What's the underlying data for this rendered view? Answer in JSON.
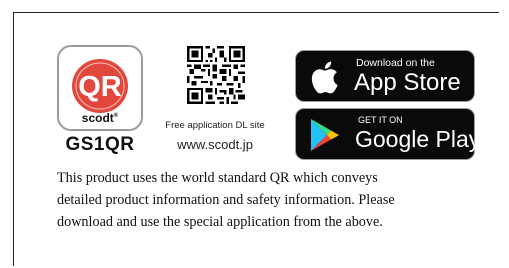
{
  "app_icon": {
    "brand": "scodt",
    "registered_mark": "®",
    "logo_text": "QR",
    "logo_color": "#e2473d",
    "name": "GS1QR"
  },
  "download_info": {
    "free_app_text": "Free application DL site",
    "site_url": "www.scodt.jp"
  },
  "store_buttons": {
    "app_store": {
      "small": "Download on the",
      "big": "App Store",
      "icon": "apple-icon"
    },
    "google_play": {
      "small": "GET IT ON",
      "big": "Google Play",
      "icon": "google-play-icon"
    }
  },
  "description": {
    "line1": "This product uses the world standard QR which conveys",
    "line2": "detailed product information and safety information. Please",
    "line3": "download and use the special application from the above."
  }
}
